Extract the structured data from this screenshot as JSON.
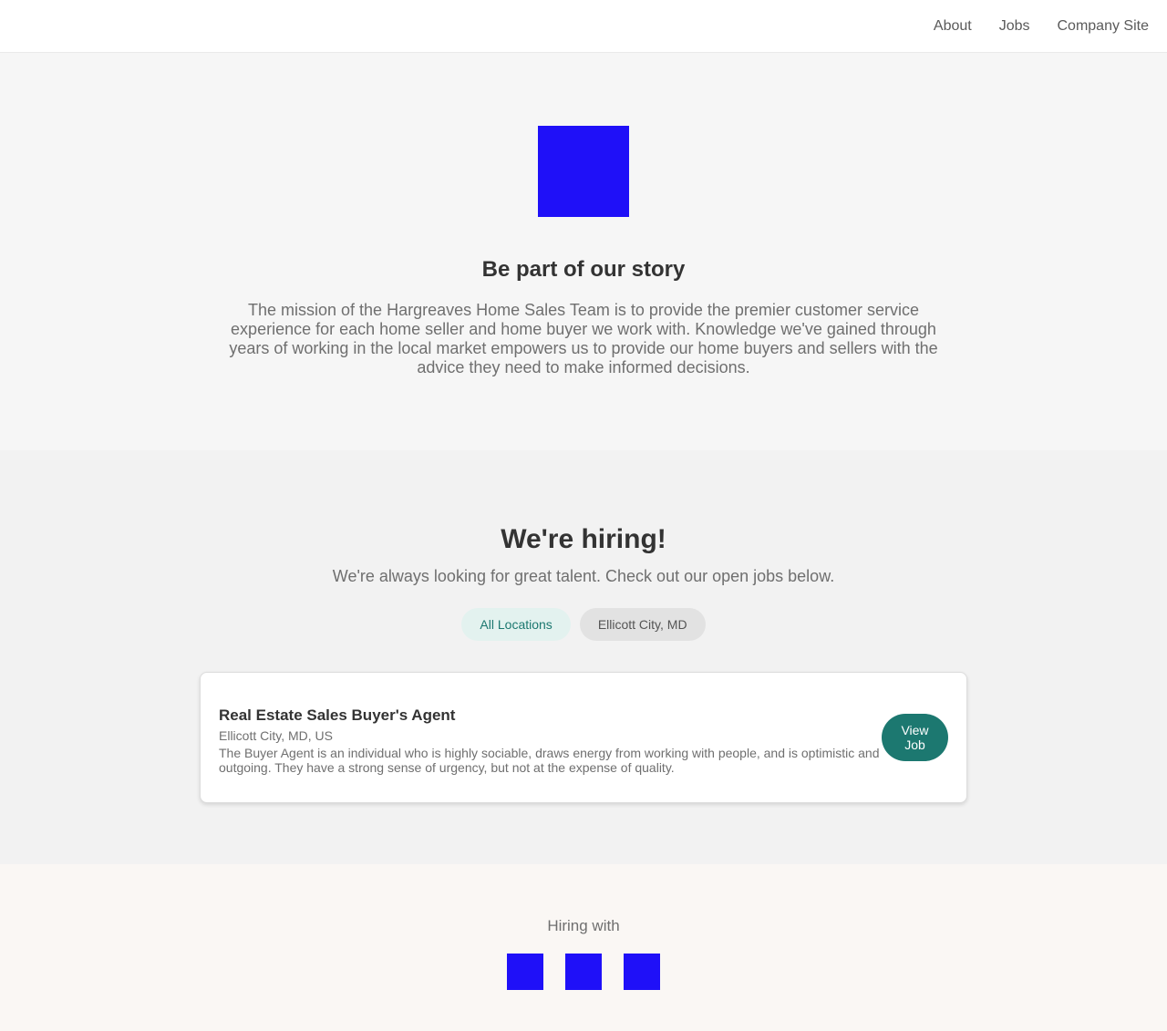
{
  "nav": {
    "items": [
      {
        "label": "About"
      },
      {
        "label": "Jobs"
      },
      {
        "label": "Company Site"
      }
    ]
  },
  "hero": {
    "title": "Be part of our story",
    "text": "The mission of the Hargreaves Home Sales Team is to provide the premier customer service experience for each home seller and home buyer we work with. Knowledge we've gained through years of working in the local market empowers us to provide our home buyers and sellers with the advice they need to make informed decisions.",
    "logo_color": "#1f10f8"
  },
  "jobs": {
    "title": "We're hiring!",
    "subtitle": "We're always looking for great talent. Check out our open jobs below.",
    "filters": [
      {
        "label": "All Locations",
        "active": true
      },
      {
        "label": "Ellicott City, MD",
        "active": false
      }
    ],
    "listings": [
      {
        "title": "Real Estate Sales Buyer's Agent",
        "location": "Ellicott City, MD, US",
        "description": "The Buyer Agent is an individual who is highly sociable, draws energy from working with people, and is optimistic and outgoing. They have a strong sense of urgency, but not at the expense of quality.",
        "button_label": "View Job"
      }
    ]
  },
  "footer": {
    "label": "Hiring with",
    "logo_color": "#1f10f8"
  },
  "colors": {
    "accent": "#1c7870",
    "accent_light": "#e3f2ef",
    "placeholder_logo": "#1f10f8"
  }
}
